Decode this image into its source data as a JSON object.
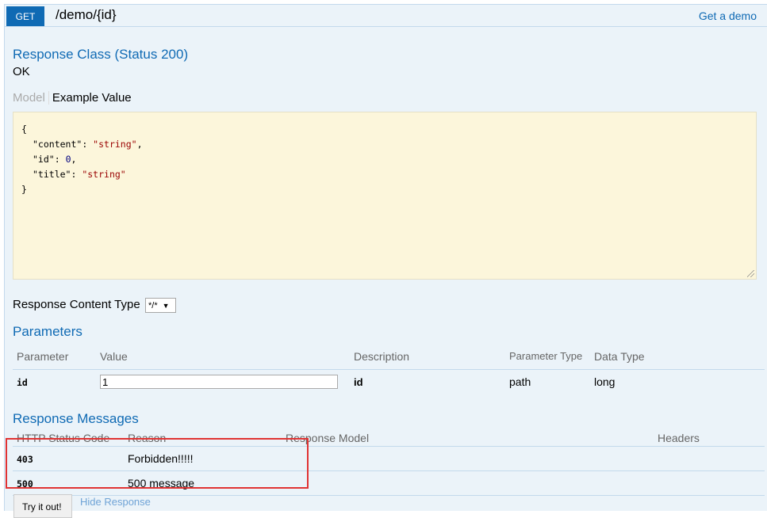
{
  "operation": {
    "method": "GET",
    "path": "/demo/{id}",
    "summary": "Get a demo"
  },
  "response_class": {
    "title": "Response Class (Status 200)",
    "status_text": "OK",
    "tabs": {
      "model": "Model",
      "example": "Example Value"
    },
    "example_json": {
      "open": "{",
      "lines": [
        {
          "key": "\"content\"",
          "value": "\"string\"",
          "type": "string",
          "suffix": ","
        },
        {
          "key": "\"id\"",
          "value": "0",
          "type": "number",
          "suffix": ","
        },
        {
          "key": "\"title\"",
          "value": "\"string\"",
          "type": "string",
          "suffix": ""
        }
      ],
      "close": "}"
    }
  },
  "response_content_type": {
    "label": "Response Content Type",
    "selected": "*/*"
  },
  "parameters": {
    "title": "Parameters",
    "headers": [
      "Parameter",
      "Value",
      "Description",
      "Parameter Type",
      "Data Type"
    ],
    "rows": [
      {
        "name": "id",
        "value": "1",
        "description": "id",
        "param_type": "path",
        "data_type": "long"
      }
    ]
  },
  "response_messages": {
    "title": "Response Messages",
    "headers": [
      "HTTP Status Code",
      "Reason",
      "Response Model",
      "Headers"
    ],
    "rows": [
      {
        "code": "403",
        "reason": "Forbidden!!!!!",
        "model": "",
        "headers": ""
      },
      {
        "code": "500",
        "reason": "500 message",
        "model": "",
        "headers": ""
      }
    ]
  },
  "actions": {
    "try_it": "Try it out!",
    "hide_response": "Hide Response"
  },
  "colors": {
    "get_badge": "#0f6ab4",
    "panel_bg": "#ebf3f9",
    "heading_text": "#0f6ab4",
    "snippet_bg": "#fcf6db",
    "highlight": "#e03333"
  }
}
